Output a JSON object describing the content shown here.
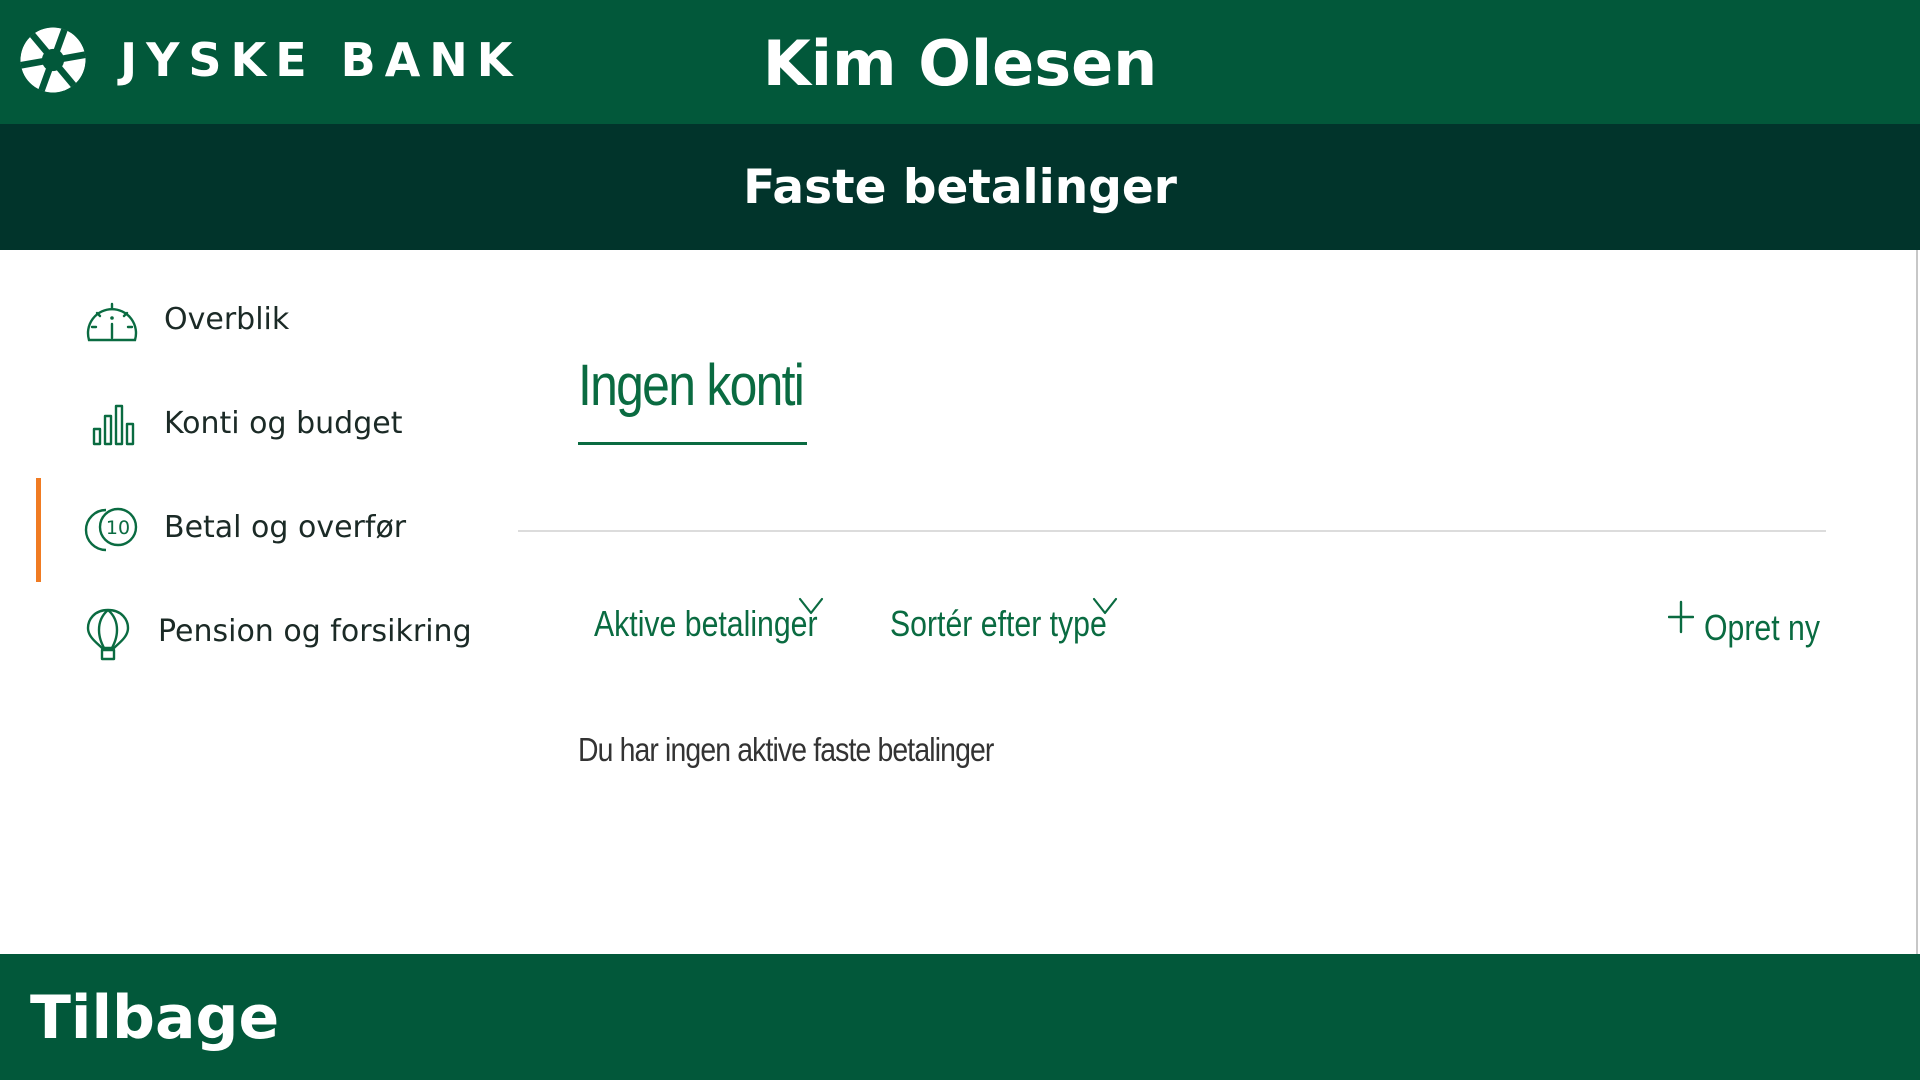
{
  "header": {
    "brand_name": "JYSKE BANK",
    "logo_icon": "jyske-bank-logo",
    "user_name": "Kim Olesen"
  },
  "title_bar": {
    "title": "Faste betalinger"
  },
  "sidebar": {
    "items": [
      {
        "label": "Overblik",
        "icon": "gauge-icon",
        "active": false
      },
      {
        "label": "Konti og budget",
        "icon": "bar-chart-icon",
        "active": false
      },
      {
        "label": "Betal og overfør",
        "icon": "coin-icon",
        "active": true,
        "icon_text": "10"
      },
      {
        "label": "Pension og forsikring",
        "icon": "hot-air-balloon-icon",
        "active": false
      }
    ]
  },
  "main": {
    "account_title": "Ingen konti",
    "filters": [
      {
        "label": "Aktive betalinger",
        "icon": "chevron-down-icon"
      },
      {
        "label": "Sortér efter type",
        "icon": "chevron-down-icon"
      }
    ],
    "create_new_label": "Opret ny",
    "empty_message": "Du har ingen aktive faste betalinger"
  },
  "footer": {
    "back_label": "Tilbage"
  },
  "colors": {
    "header_green": "#02583a",
    "title_bar_dark_green": "#01342b",
    "accent_green_text": "#0a6b41",
    "active_indicator_orange": "#f07b22"
  }
}
